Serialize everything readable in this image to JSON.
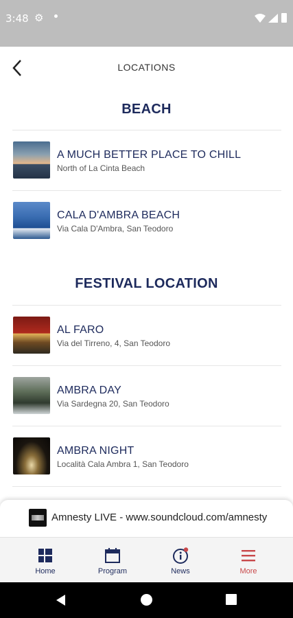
{
  "status_bar": {
    "time": "3:48"
  },
  "header": {
    "title": "LOCATIONS"
  },
  "sections": [
    {
      "title": "BEACH",
      "items": [
        {
          "name": "A MUCH BETTER PLACE TO CHILL",
          "address": "North of La Cinta Beach"
        },
        {
          "name": "CALA D'AMBRA BEACH",
          "address": "Via Cala D'Ambra, San Teodoro"
        }
      ]
    },
    {
      "title": "FESTIVAL LOCATION",
      "items": [
        {
          "name": "AL FARO",
          "address": "Via del Tirreno, 4, San Teodoro"
        },
        {
          "name": "AMBRA DAY",
          "address": "Via Sardegna 20, San Teodoro"
        },
        {
          "name": "AMBRA NIGHT",
          "address": "Località Cala Ambra 1, San Teodoro"
        }
      ]
    }
  ],
  "player": {
    "text": "Amnesty LIVE - www.soundcloud.com/amnesty"
  },
  "bottom_nav": [
    {
      "label": "Home",
      "icon": "grid-icon"
    },
    {
      "label": "Program",
      "icon": "calendar-icon"
    },
    {
      "label": "News",
      "icon": "info-icon"
    },
    {
      "label": "More",
      "icon": "menu-icon",
      "active": true
    }
  ],
  "colors": {
    "navy": "#1d2a5c",
    "active": "#c8484a",
    "status_bar": "#bdbdbd"
  }
}
